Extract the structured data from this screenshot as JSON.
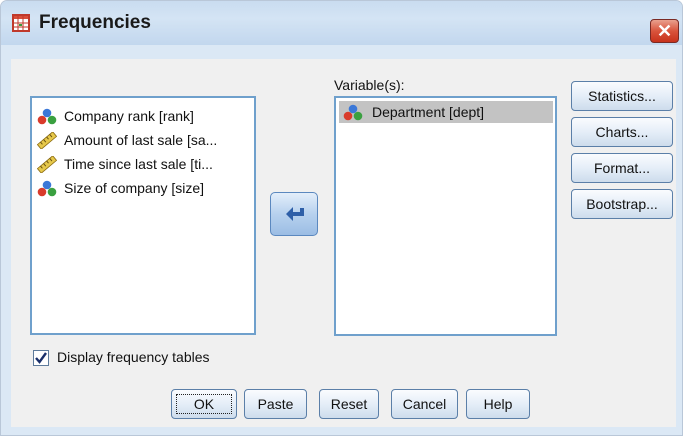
{
  "window": {
    "title": "Frequencies",
    "close_glyph": "✕"
  },
  "source_list": {
    "items": [
      {
        "icon": "nominal-variable-icon",
        "label": "Company rank [rank]"
      },
      {
        "icon": "scale-variable-icon",
        "label": "Amount of last sale [sa..."
      },
      {
        "icon": "scale-variable-icon",
        "label": "Time since last sale [ti..."
      },
      {
        "icon": "nominal-variable-icon",
        "label": "Size of company [size]"
      }
    ]
  },
  "target": {
    "label": "Variable(s):",
    "items": [
      {
        "icon": "nominal-variable-icon",
        "label": "Department [dept]"
      }
    ]
  },
  "side_buttons": {
    "statistics": "Statistics...",
    "charts": "Charts...",
    "format": "Format...",
    "bootstrap": "Bootstrap..."
  },
  "options": {
    "display_freq_label": "Display frequency tables",
    "display_freq_checked": true
  },
  "bottom_buttons": {
    "ok": "OK",
    "paste": "Paste",
    "reset": "Reset",
    "cancel": "Cancel",
    "help": "Help"
  },
  "colors": {
    "window_border": "#b9c7d8",
    "list_border": "#6fa0cc",
    "close_red": "#d9543c",
    "selection_gray": "#c3c3c3"
  }
}
